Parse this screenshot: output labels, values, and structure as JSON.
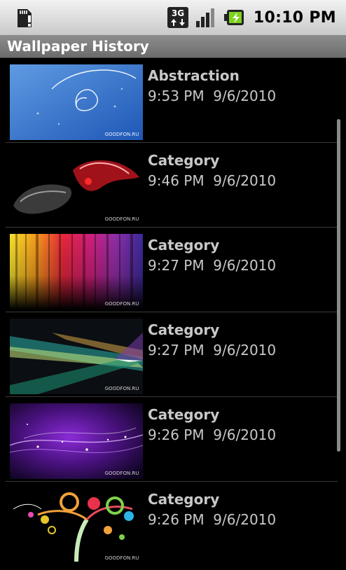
{
  "status_bar": {
    "time": "10:10 PM",
    "network": "3G",
    "icons": [
      "sd-card-alert-icon",
      "3g-data-icon",
      "signal-strength-icon",
      "battery-charging-icon"
    ]
  },
  "app": {
    "title": "Wallpaper History"
  },
  "history": [
    {
      "name": "Abstraction",
      "time": "9:53 PM",
      "date": "9/6/2010",
      "stamp": "9:53 PM  9/6/2010",
      "watermark": "GOODFON.RU"
    },
    {
      "name": "Category",
      "time": "9:46 PM",
      "date": "9/6/2010",
      "stamp": "9:46 PM  9/6/2010",
      "watermark": "GOODFON.RU"
    },
    {
      "name": "Category",
      "time": "9:27 PM",
      "date": "9/6/2010",
      "stamp": "9:27 PM  9/6/2010",
      "watermark": "GOODFON.RU"
    },
    {
      "name": "Category",
      "time": "9:27 PM",
      "date": "9/6/2010",
      "stamp": "9:27 PM  9/6/2010",
      "watermark": "GOODFON.RU"
    },
    {
      "name": "Category",
      "time": "9:26 PM",
      "date": "9/6/2010",
      "stamp": "9:26 PM  9/6/2010",
      "watermark": "GOODFON.RU"
    },
    {
      "name": "Category",
      "time": "9:26 PM",
      "date": "9/6/2010",
      "stamp": "9:26 PM  9/6/2010",
      "watermark": "GOODFON.RU"
    }
  ]
}
